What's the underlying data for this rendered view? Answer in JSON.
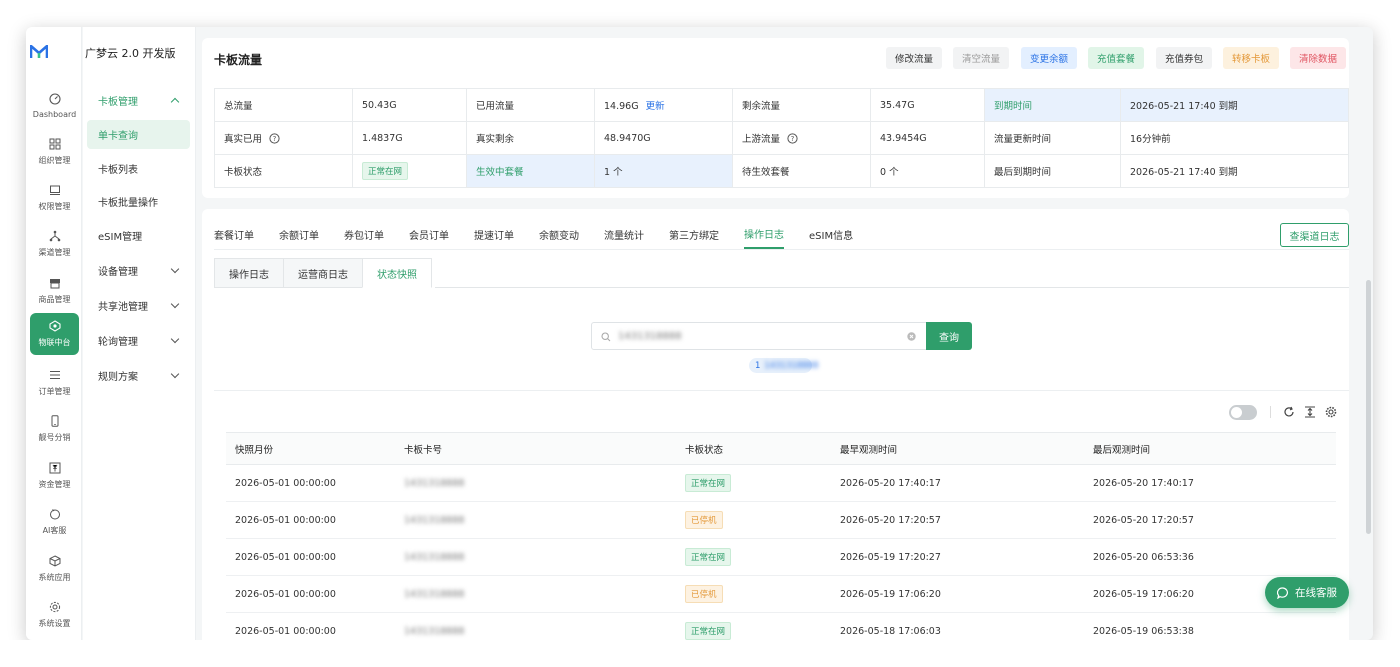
{
  "app": {
    "title": "广梦云 2.0 开发版",
    "logo_glyph": "M",
    "brand_color": "#2f9e6b"
  },
  "icon_nav": [
    {
      "label": "Dashboard",
      "icon": "dashboard-icon"
    },
    {
      "label": "组织管理",
      "icon": "grid-icon"
    },
    {
      "label": "权限管理",
      "icon": "monitor-icon"
    },
    {
      "label": "渠道管理",
      "icon": "network-icon"
    },
    {
      "label": "商品管理",
      "icon": "store-icon"
    },
    {
      "label": "物联中台",
      "icon": "iot-icon",
      "active": true
    },
    {
      "label": "订单管理",
      "icon": "list-icon"
    },
    {
      "label": "靓号分销",
      "icon": "phone-icon"
    },
    {
      "label": "资金管理",
      "icon": "yuan-icon"
    },
    {
      "label": "AI客服",
      "icon": "ai-icon"
    },
    {
      "label": "系统应用",
      "icon": "cube-icon"
    },
    {
      "label": "系统设置",
      "icon": "gear-icon"
    }
  ],
  "submenu": {
    "items": [
      "卡板管理",
      "单卡查询",
      "卡板列表",
      "卡板批量操作",
      "eSIM管理",
      "设备管理",
      "共享池管理",
      "轮询管理",
      "规则方案"
    ]
  },
  "header": {
    "title": "卡板流量",
    "buttons": [
      "修改流量",
      "清空流量",
      "变更余额",
      "充值套餐",
      "充值券包",
      "转移卡板",
      "清除数据"
    ]
  },
  "info": {
    "rows": [
      [
        "总流量",
        "50.43G",
        "已用流量",
        "14.96G",
        "剩余流量",
        "35.47G",
        "到期时间",
        "2026-05-21 17:40 到期"
      ],
      [
        "真实已用",
        "1.4837G",
        "真实剩余",
        "48.9470G",
        "上游流量",
        "43.9454G",
        "流量更新时间",
        "16分钟前"
      ],
      [
        "卡板状态",
        "正常在网",
        "生效中套餐",
        "1 个",
        "待生效套餐",
        "0 个",
        "最后到期时间",
        "2026-05-21 17:40 到期"
      ]
    ],
    "update_link": "更新"
  },
  "tabs": {
    "items": [
      "套餐订单",
      "余额订单",
      "券包订单",
      "会员订单",
      "提速订单",
      "余额变动",
      "流量统计",
      "第三方绑定",
      "操作日志",
      "eSIM信息"
    ],
    "active": "操作日志",
    "channel_log_button": "查渠道日志"
  },
  "subtabs": {
    "items": [
      "操作日志",
      "运营商日志",
      "状态快照"
    ],
    "active": "状态快照"
  },
  "search": {
    "value": "1431318888",
    "button": "查询",
    "count_chip": "1"
  },
  "table": {
    "headers": [
      "快照月份",
      "卡板卡号",
      "卡板状态",
      "最早观测时间",
      "最后观测时间"
    ],
    "rows": [
      [
        "2026-05-01 00:00:00",
        "1431318888",
        "正常在网",
        "2026-05-20 17:40:17",
        "2026-05-20 17:40:17"
      ],
      [
        "2026-05-01 00:00:00",
        "1431318888",
        "已停机",
        "2026-05-20 17:20:57",
        "2026-05-20 17:20:57"
      ],
      [
        "2026-05-01 00:00:00",
        "1431318888",
        "正常在网",
        "2026-05-19 17:20:27",
        "2026-05-20 06:53:36"
      ],
      [
        "2026-05-01 00:00:00",
        "1431318888",
        "已停机",
        "2026-05-19 17:06:20",
        "2026-05-19 17:06:20"
      ],
      [
        "2026-05-01 00:00:00",
        "1431318888",
        "正常在网",
        "2026-05-18 17:06:03",
        "2026-05-19 06:53:38"
      ]
    ]
  },
  "fab": {
    "label": "在线客服"
  }
}
